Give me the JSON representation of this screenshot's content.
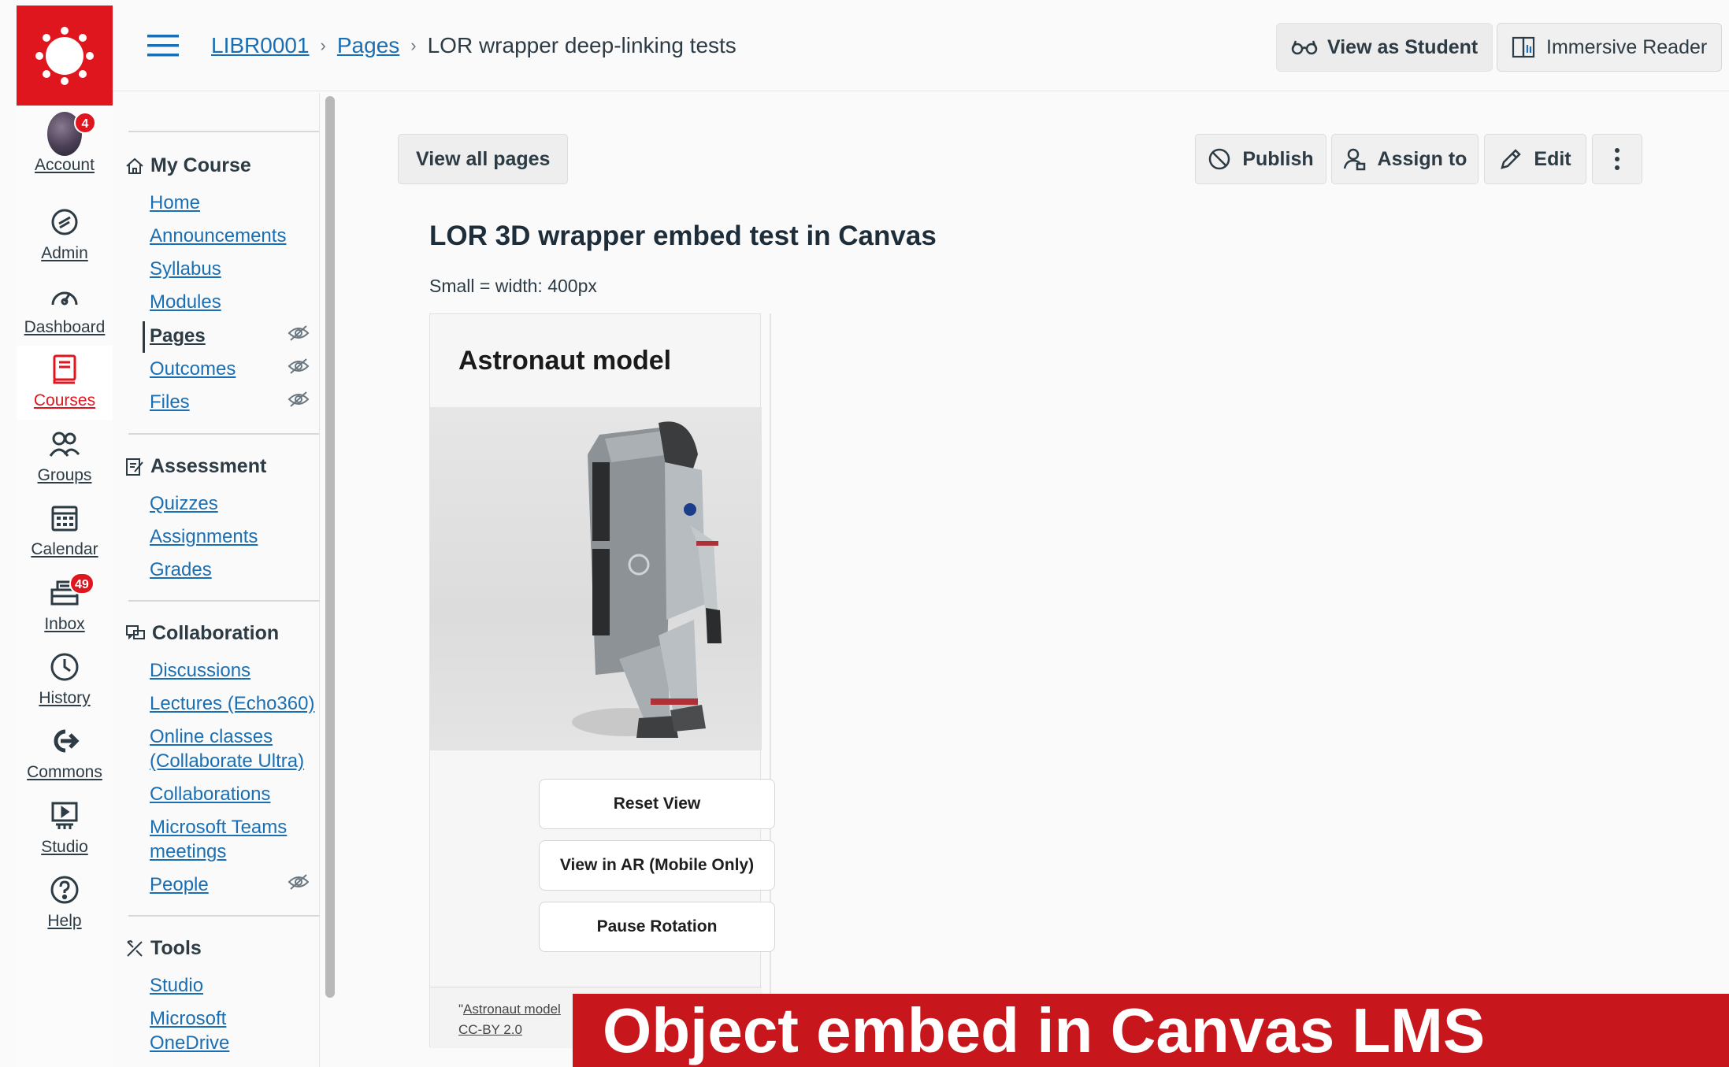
{
  "global_nav": {
    "items": [
      {
        "label": "Account",
        "icon": "avatar",
        "badge": "4"
      },
      {
        "label": "Admin",
        "icon": "shield-icon"
      },
      {
        "label": "Dashboard",
        "icon": "speedometer-icon"
      },
      {
        "label": "Courses",
        "icon": "book-icon",
        "active": true
      },
      {
        "label": "Groups",
        "icon": "groups-icon"
      },
      {
        "label": "Calendar",
        "icon": "calendar-icon"
      },
      {
        "label": "Inbox",
        "icon": "inbox-icon",
        "badge": "49"
      },
      {
        "label": "History",
        "icon": "clock-icon"
      },
      {
        "label": "Commons",
        "icon": "commons-icon"
      },
      {
        "label": "Studio",
        "icon": "studio-icon"
      },
      {
        "label": "Help",
        "icon": "help-icon"
      }
    ]
  },
  "header": {
    "breadcrumb": [
      "LIBR0001",
      "Pages",
      "LOR wrapper deep-linking tests"
    ],
    "view_as_student": "View as Student",
    "immersive_reader": "Immersive Reader"
  },
  "course_nav": {
    "sections": [
      {
        "title": "My Course",
        "links": [
          "Home",
          "Announcements",
          "Syllabus",
          "Modules",
          "Pages",
          "Outcomes",
          "Files"
        ]
      },
      {
        "title": "Assessment",
        "links": [
          "Quizzes",
          "Assignments",
          "Grades"
        ]
      },
      {
        "title": "Collaboration",
        "links": [
          "Discussions",
          "Lectures (Echo360)",
          "Online classes",
          "(Collaborate Ultra)",
          "Collaborations",
          "Microsoft Teams",
          "meetings",
          "People"
        ]
      },
      {
        "title": "Tools",
        "links": [
          "Studio",
          "Microsoft",
          "OneDrive"
        ]
      }
    ],
    "current": "Pages"
  },
  "main": {
    "view_all_pages": "View all pages",
    "publish": "Publish",
    "assign_to": "Assign to",
    "edit": "Edit",
    "title": "LOR 3D wrapper embed test in Canvas",
    "size_note": "Small = width: 400px"
  },
  "embed": {
    "title": "Astronaut model",
    "buttons": [
      "Reset View",
      "View in AR (Mobile Only)",
      "Pause Rotation"
    ],
    "credit_prefix": "\"",
    "credit_link": "Astronaut model",
    "credit_license": "CC-BY 2.0"
  },
  "caption": "Object embed in Canvas LMS",
  "colors": {
    "brand": "#e0161e",
    "link": "#1a6fb4",
    "text": "#2d3b45",
    "banner": "#c8161d"
  }
}
